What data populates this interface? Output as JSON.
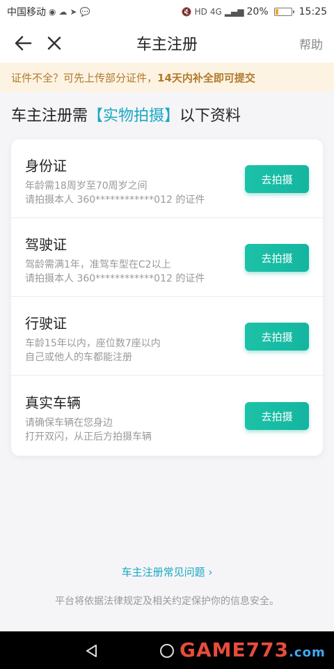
{
  "status_bar": {
    "carrier": "中国移动",
    "network": "4G",
    "battery": "20%",
    "battery_level": 0.2,
    "time": "15:25"
  },
  "header": {
    "title": "车主注册",
    "help": "帮助"
  },
  "notice": {
    "prefix": "证件不全？可先上传部分证件，",
    "highlight": "14天内补全即可提交"
  },
  "section": {
    "prefix": "车主注册需",
    "highlight": "【实物拍摄】",
    "suffix": "以下资料"
  },
  "documents": [
    {
      "name": "身份证",
      "line1": "年龄需18周岁至70周岁之间",
      "line2": "请拍摄本人 360************012 的证件",
      "button": "去拍摄"
    },
    {
      "name": "驾驶证",
      "line1": "驾龄需满1年，准驾车型在C2以上",
      "line2": "请拍摄本人 360************012 的证件",
      "button": "去拍摄"
    },
    {
      "name": "行驶证",
      "line1": "车龄15年以内，座位数7座以内",
      "line2": "自己或他人的车都能注册",
      "button": "去拍摄"
    },
    {
      "name": "真实车辆",
      "line1": "请确保车辆在您身边",
      "line2": "打开双闪，从正后方拍摄车辆",
      "button": "去拍摄"
    }
  ],
  "faq_link": "车主注册常见问题 ›",
  "footer_note": "平台将依据法律规定及相关约定保护你的信息安全。",
  "watermark": {
    "main": "GAME773",
    "sub": ".com"
  },
  "colors": {
    "accent": "#1aa8c4",
    "button": "#14b5a0",
    "notice_bg": "#fdf3e3",
    "notice_text": "#b07a2c"
  }
}
